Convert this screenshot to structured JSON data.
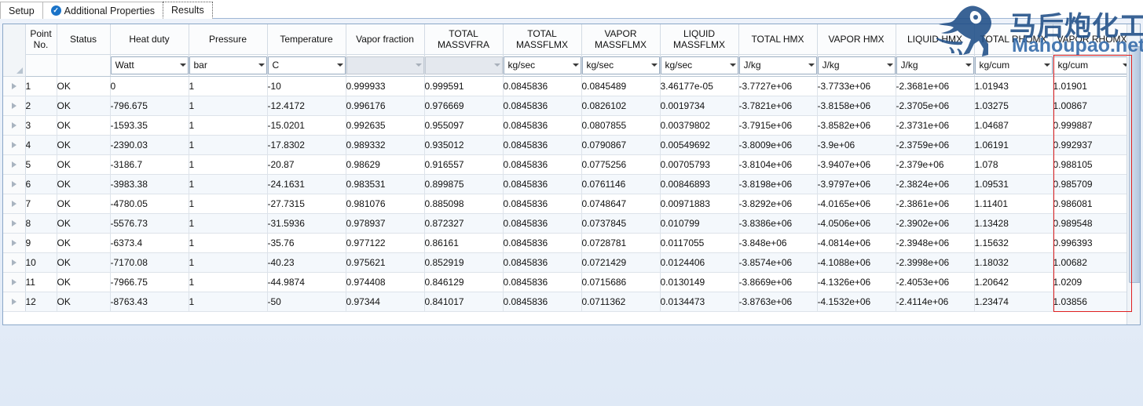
{
  "tabs": [
    {
      "label": "Setup",
      "icon": null,
      "active": false
    },
    {
      "label": "Additional Properties",
      "icon": "check-circle-icon",
      "active": false
    },
    {
      "label": "Results",
      "icon": null,
      "active": true
    }
  ],
  "watermark": {
    "cn_text": "马后炮化工",
    "en_text": "Mahoupao.net",
    "icon": "horse-logo-icon",
    "color": "#1f4e87"
  },
  "highlight": {
    "color": "#e02020",
    "target_column": "VAPOR RHOMX"
  },
  "grid": {
    "row_header_icon": "row-arrow-icon",
    "corner_icon": "select-all-corner-icon",
    "columns": [
      {
        "title": "Point No.",
        "unit": null,
        "unit_enabled": false,
        "kind": "index"
      },
      {
        "title": "Status",
        "unit": null,
        "unit_enabled": false,
        "kind": "text"
      },
      {
        "title": "Heat duty",
        "unit": "Watt",
        "unit_enabled": true,
        "kind": "number"
      },
      {
        "title": "Pressure",
        "unit": "bar",
        "unit_enabled": true,
        "kind": "number"
      },
      {
        "title": "Temperature",
        "unit": "C",
        "unit_enabled": true,
        "kind": "number"
      },
      {
        "title": "Vapor fraction",
        "unit": "",
        "unit_enabled": false,
        "kind": "number"
      },
      {
        "title": "TOTAL MASSVFRA",
        "unit": "",
        "unit_enabled": false,
        "kind": "number"
      },
      {
        "title": "TOTAL MASSFLMX",
        "unit": "kg/sec",
        "unit_enabled": true,
        "kind": "number"
      },
      {
        "title": "VAPOR MASSFLMX",
        "unit": "kg/sec",
        "unit_enabled": true,
        "kind": "number"
      },
      {
        "title": "LIQUID MASSFLMX",
        "unit": "kg/sec",
        "unit_enabled": true,
        "kind": "number"
      },
      {
        "title": "TOTAL HMX",
        "unit": "J/kg",
        "unit_enabled": true,
        "kind": "number"
      },
      {
        "title": "VAPOR HMX",
        "unit": "J/kg",
        "unit_enabled": true,
        "kind": "number"
      },
      {
        "title": "LIQUID HMX",
        "unit": "J/kg",
        "unit_enabled": true,
        "kind": "number"
      },
      {
        "title": "TOTAL RHOMX",
        "unit": "kg/cum",
        "unit_enabled": true,
        "kind": "number"
      },
      {
        "title": "VAPOR RHOMX",
        "unit": "kg/cum",
        "unit_enabled": true,
        "kind": "number"
      }
    ],
    "rows": [
      [
        "1",
        "OK",
        "0",
        "1",
        "-10",
        "0.999933",
        "0.999591",
        "0.0845836",
        "0.0845489",
        "3.46177e-05",
        "-3.7727e+06",
        "-3.7733e+06",
        "-2.3681e+06",
        "1.01943",
        "1.01901"
      ],
      [
        "2",
        "OK",
        "-796.675",
        "1",
        "-12.4172",
        "0.996176",
        "0.976669",
        "0.0845836",
        "0.0826102",
        "0.0019734",
        "-3.7821e+06",
        "-3.8158e+06",
        "-2.3705e+06",
        "1.03275",
        "1.00867"
      ],
      [
        "3",
        "OK",
        "-1593.35",
        "1",
        "-15.0201",
        "0.992635",
        "0.955097",
        "0.0845836",
        "0.0807855",
        "0.00379802",
        "-3.7915e+06",
        "-3.8582e+06",
        "-2.3731e+06",
        "1.04687",
        "0.999887"
      ],
      [
        "4",
        "OK",
        "-2390.03",
        "1",
        "-17.8302",
        "0.989332",
        "0.935012",
        "0.0845836",
        "0.0790867",
        "0.00549692",
        "-3.8009e+06",
        "-3.9e+06",
        "-2.3759e+06",
        "1.06191",
        "0.992937"
      ],
      [
        "5",
        "OK",
        "-3186.7",
        "1",
        "-20.87",
        "0.98629",
        "0.916557",
        "0.0845836",
        "0.0775256",
        "0.00705793",
        "-3.8104e+06",
        "-3.9407e+06",
        "-2.379e+06",
        "1.078",
        "0.988105"
      ],
      [
        "6",
        "OK",
        "-3983.38",
        "1",
        "-24.1631",
        "0.983531",
        "0.899875",
        "0.0845836",
        "0.0761146",
        "0.00846893",
        "-3.8198e+06",
        "-3.9797e+06",
        "-2.3824e+06",
        "1.09531",
        "0.985709"
      ],
      [
        "7",
        "OK",
        "-4780.05",
        "1",
        "-27.7315",
        "0.981076",
        "0.885098",
        "0.0845836",
        "0.0748647",
        "0.00971883",
        "-3.8292e+06",
        "-4.0165e+06",
        "-2.3861e+06",
        "1.11401",
        "0.986081"
      ],
      [
        "8",
        "OK",
        "-5576.73",
        "1",
        "-31.5936",
        "0.978937",
        "0.872327",
        "0.0845836",
        "0.0737845",
        "0.010799",
        "-3.8386e+06",
        "-4.0506e+06",
        "-2.3902e+06",
        "1.13428",
        "0.989548"
      ],
      [
        "9",
        "OK",
        "-6373.4",
        "1",
        "-35.76",
        "0.977122",
        "0.86161",
        "0.0845836",
        "0.0728781",
        "0.0117055",
        "-3.848e+06",
        "-4.0814e+06",
        "-2.3948e+06",
        "1.15632",
        "0.996393"
      ],
      [
        "10",
        "OK",
        "-7170.08",
        "1",
        "-40.23",
        "0.975621",
        "0.852919",
        "0.0845836",
        "0.0721429",
        "0.0124406",
        "-3.8574e+06",
        "-4.1088e+06",
        "-2.3998e+06",
        "1.18032",
        "1.00682"
      ],
      [
        "11",
        "OK",
        "-7966.75",
        "1",
        "-44.9874",
        "0.974408",
        "0.846129",
        "0.0845836",
        "0.0715686",
        "0.0130149",
        "-3.8669e+06",
        "-4.1326e+06",
        "-2.4053e+06",
        "1.20642",
        "1.0209"
      ],
      [
        "12",
        "OK",
        "-8763.43",
        "1",
        "-50",
        "0.97344",
        "0.841017",
        "0.0845836",
        "0.0711362",
        "0.0134473",
        "-3.8763e+06",
        "-4.1532e+06",
        "-2.4114e+06",
        "1.23474",
        "1.03856"
      ]
    ]
  }
}
